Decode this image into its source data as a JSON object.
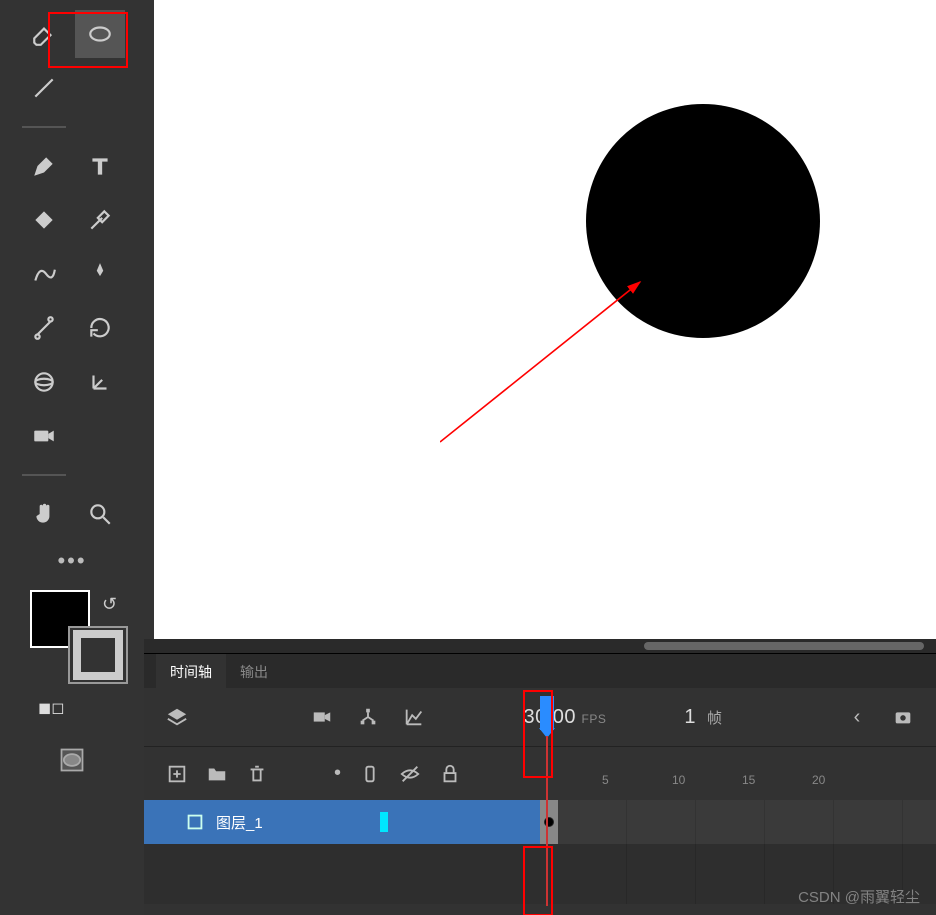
{
  "tools": {
    "ellipse_highlight": true
  },
  "canvas": {
    "shape": "circle",
    "fill": "#000000"
  },
  "panel": {
    "tabs": {
      "timeline": "时间轴",
      "output": "输出"
    },
    "fps_value": "30.00",
    "fps_label": "FPS",
    "current_frame": "1",
    "frame_label": "帧",
    "ruler_ticks": [
      "5",
      "10",
      "15",
      "20"
    ]
  },
  "layer": {
    "name": "图层_1"
  },
  "watermark": "CSDN @雨翼轻尘"
}
